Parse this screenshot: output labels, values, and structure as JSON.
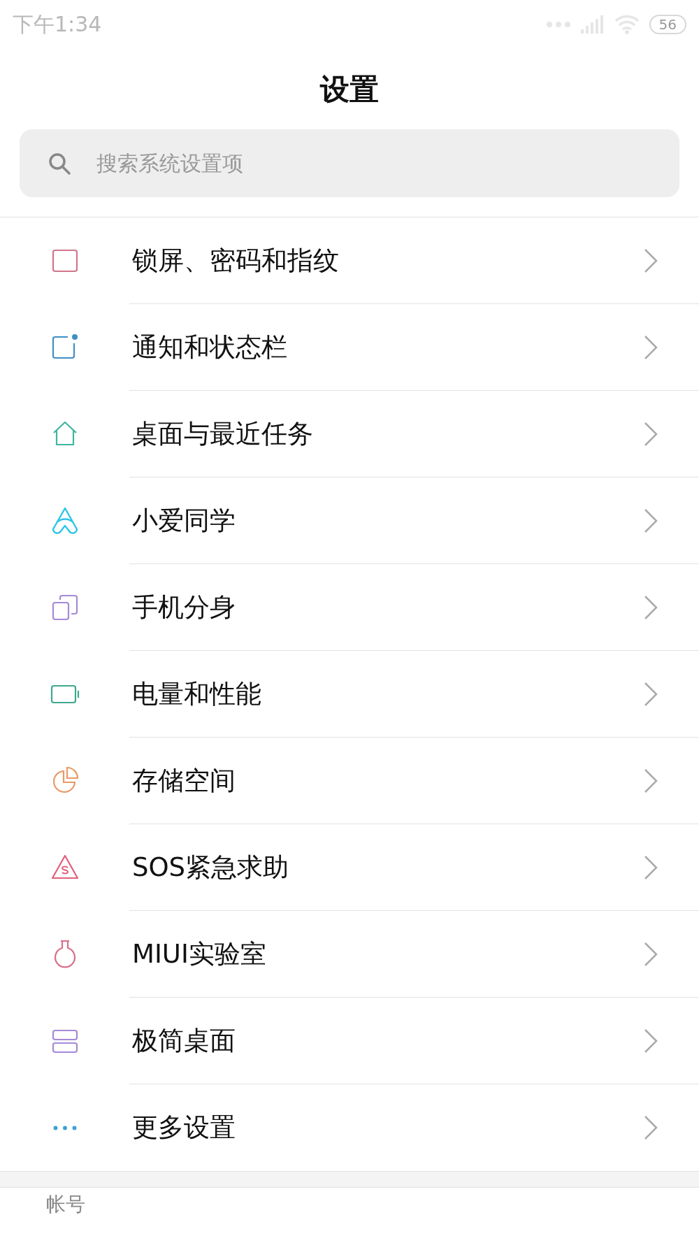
{
  "status_bar": {
    "time": "下午1:34",
    "battery": "56"
  },
  "title": "设置",
  "search": {
    "placeholder": "搜索系统设置项"
  },
  "items": [
    {
      "label": "锁屏、密码和指纹",
      "color": "#d0768a"
    },
    {
      "label": "通知和状态栏",
      "color": "#3f8fc4"
    },
    {
      "label": "桌面与最近任务",
      "color": "#3fb5a0"
    },
    {
      "label": "小爱同学",
      "color": "#2ec4e8"
    },
    {
      "label": "手机分身",
      "color": "#a68ad8"
    },
    {
      "label": "电量和性能",
      "color": "#3fa88e"
    },
    {
      "label": "存储空间",
      "color": "#e89a66"
    },
    {
      "label": "SOS紧急求助",
      "color": "#e0607a"
    },
    {
      "label": "MIUI实验室",
      "color": "#d8708a"
    },
    {
      "label": "极简桌面",
      "color": "#a68ad8"
    },
    {
      "label": "更多设置",
      "color": "#3fa0d0"
    }
  ],
  "section_header": "帐号"
}
